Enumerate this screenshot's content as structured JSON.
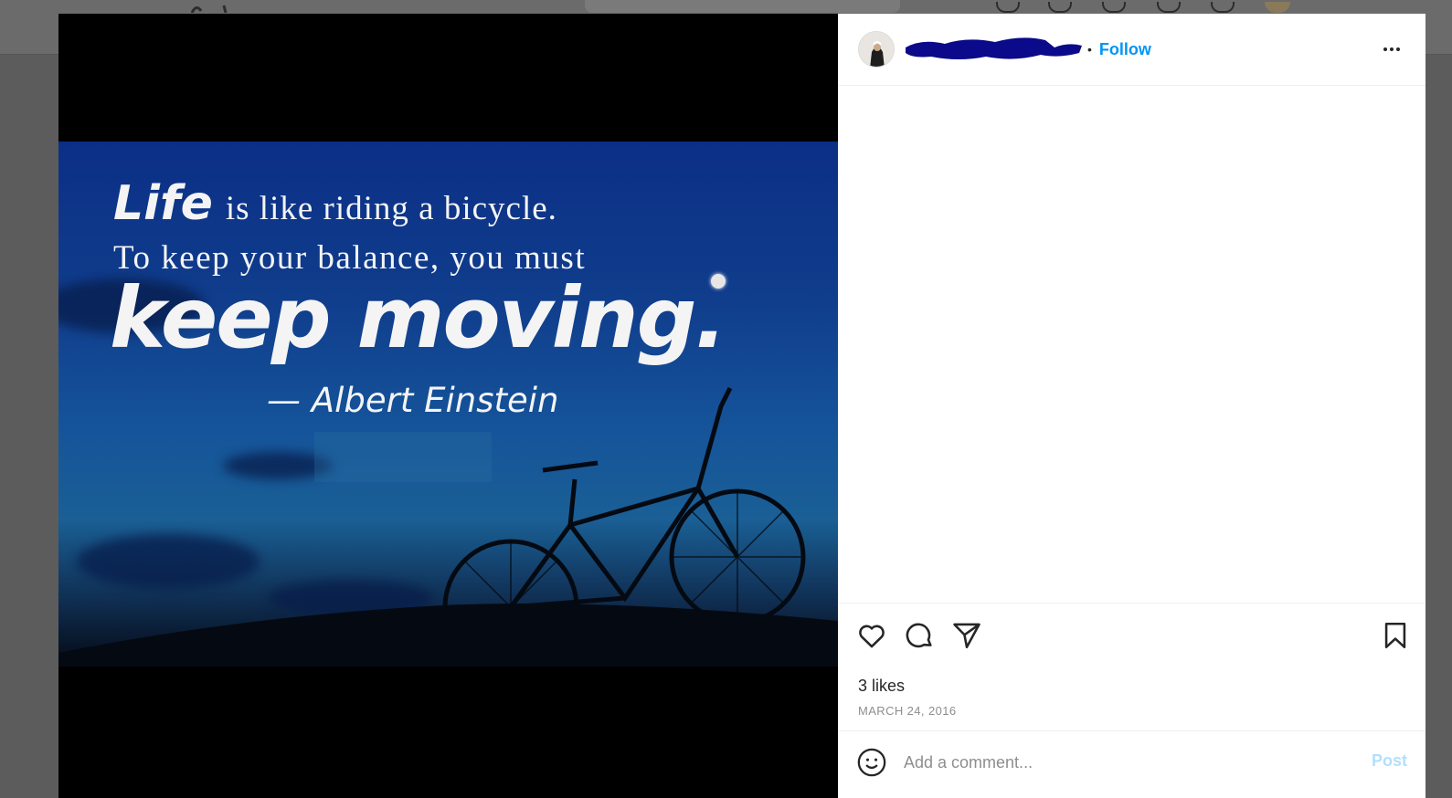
{
  "header": {
    "username": "",
    "separator": "•",
    "follow_label": "Follow"
  },
  "post_image": {
    "quote_life": "Life",
    "quote_line1_rest": "is like riding a bicycle.",
    "quote_line2": "To keep your balance, you must",
    "quote_line3": "keep moving.",
    "quote_author": "— Albert Einstein"
  },
  "actions": {
    "likes_text": "3 likes",
    "date_text": "MARCH 24, 2016"
  },
  "comment_box": {
    "placeholder": "Add a comment...",
    "post_label": "Post"
  },
  "icons": [
    "heart-icon",
    "comment-icon",
    "share-icon",
    "bookmark-icon",
    "emoji-icon",
    "more-options-icon"
  ],
  "colors": {
    "accent": "#0095f6",
    "post_disabled": "#b2dffc",
    "redaction": "#0a0a8a"
  }
}
